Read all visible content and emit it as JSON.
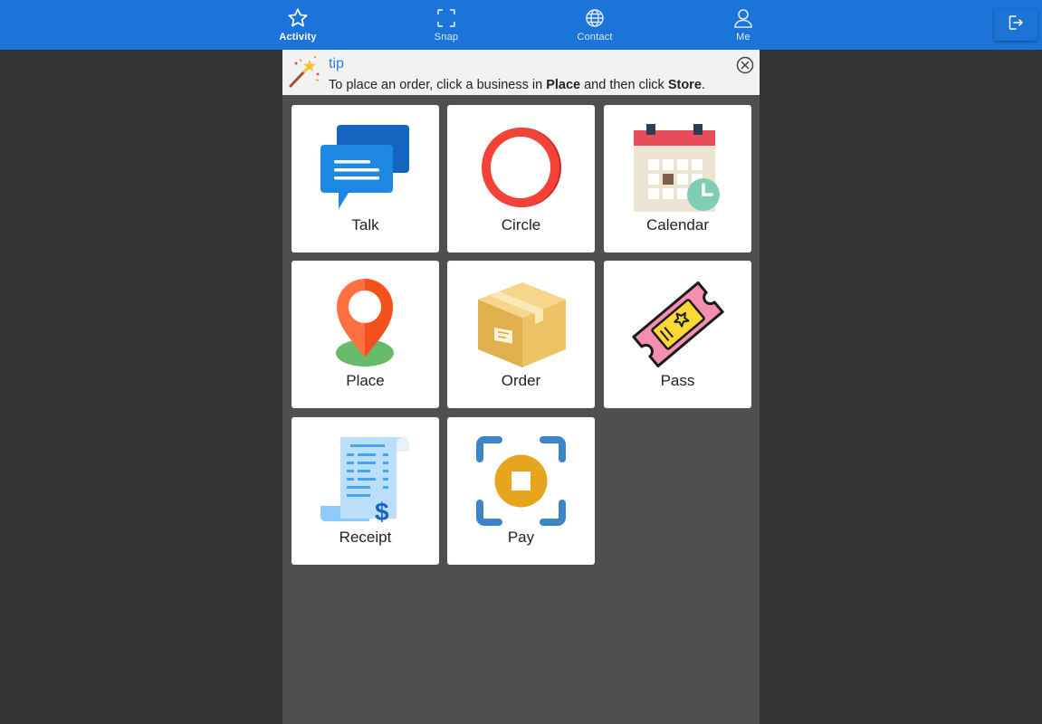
{
  "nav": {
    "items": [
      {
        "label": "Activity",
        "icon": "star-icon",
        "active": true
      },
      {
        "label": "Snap",
        "icon": "scan-frame-icon",
        "active": false
      },
      {
        "label": "Contact",
        "icon": "globe-icon",
        "active": false
      },
      {
        "label": "Me",
        "icon": "person-icon",
        "active": false
      }
    ],
    "logout_icon": "logout-icon"
  },
  "tip": {
    "title": "tip",
    "text_1": "To place an order, click a business in ",
    "bold_1": "Place",
    "text_2": " and then click ",
    "bold_2": "Store",
    "text_3": ".",
    "icon": "magic-wand-icon",
    "close_icon": "close-circle-icon"
  },
  "tiles": [
    {
      "label": "Talk",
      "icon": "chat-bubbles-icon"
    },
    {
      "label": "Circle",
      "icon": "red-ring-icon"
    },
    {
      "label": "Calendar",
      "icon": "calendar-clock-icon"
    },
    {
      "label": "Place",
      "icon": "map-pin-icon"
    },
    {
      "label": "Order",
      "icon": "box-icon"
    },
    {
      "label": "Pass",
      "icon": "ticket-icon"
    },
    {
      "label": "Receipt",
      "icon": "receipt-icon"
    },
    {
      "label": "Pay",
      "icon": "scan-pay-icon"
    }
  ],
  "colors": {
    "topbar": "#1b74d9",
    "background": "#333333",
    "panel": "#4f4f4f",
    "tip_title": "#2f7ed8"
  }
}
